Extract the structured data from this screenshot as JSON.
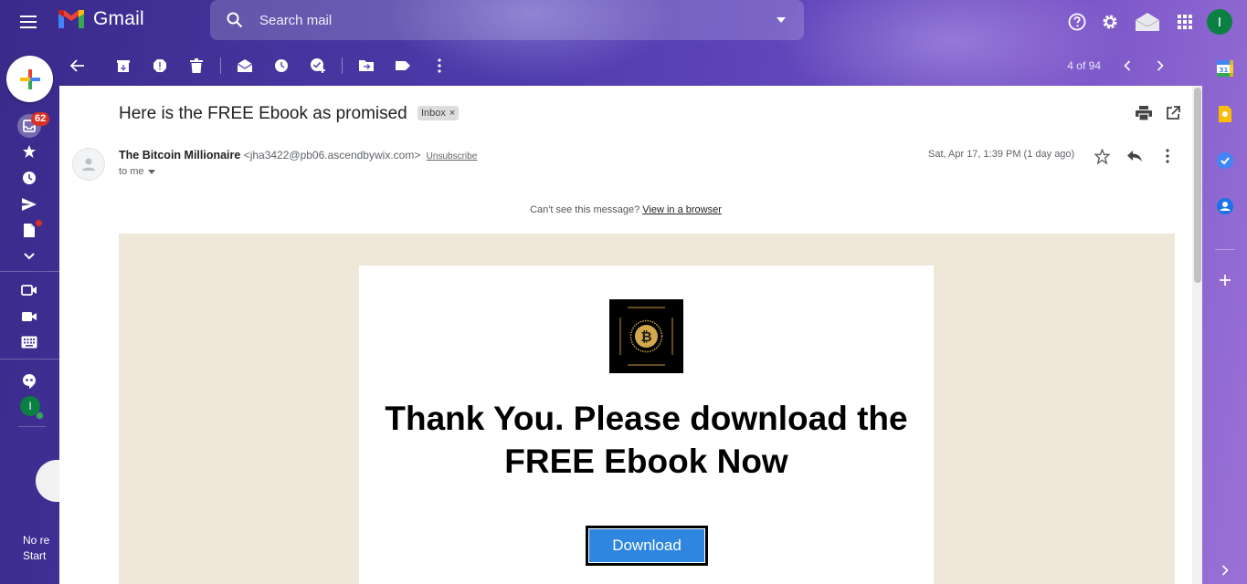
{
  "app": {
    "name": "Gmail",
    "search_placeholder": "Search mail",
    "user_initial": "I"
  },
  "left_rail": {
    "inbox_badge": "62",
    "rail_text_line1": "No re",
    "rail_text_line2": "Start"
  },
  "toolbar": {
    "pager_text": "4 of 94"
  },
  "email": {
    "subject": "Here is the FREE Ebook as promised",
    "label": "Inbox",
    "label_remove": "×",
    "sender_name": "The Bitcoin Millionaire",
    "sender_email": "<jha3422@pb06.ascendbywix.com>",
    "unsubscribe": "Unsubscribe",
    "to": "to me",
    "date": "Sat, Apr 17, 1:39 PM (1 day ago)",
    "cant_see_text": "Can't see this message?",
    "view_in_browser": "View in a browser",
    "headline": "Thank You. Please download the FREE Ebook Now",
    "download_label": "Download"
  },
  "colors": {
    "accent_green": "#0b8043",
    "badge_red": "#d93025",
    "body_beige": "#efe7d8",
    "download_blue": "#2f86de"
  }
}
